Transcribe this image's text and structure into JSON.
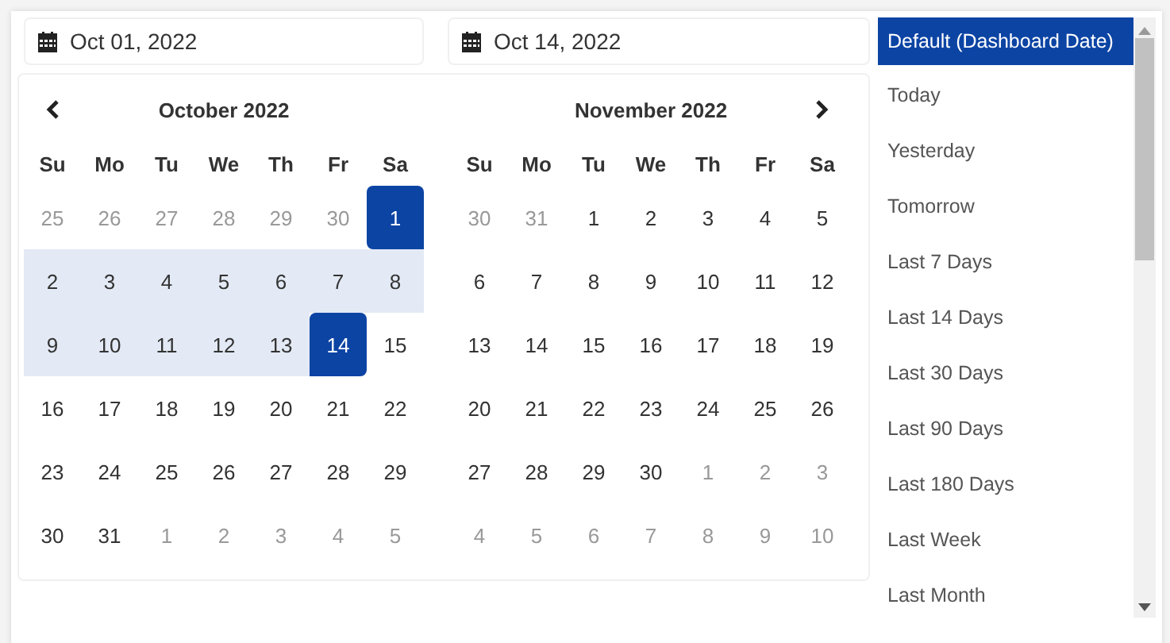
{
  "start_field": {
    "value": "Oct 01, 2022"
  },
  "end_field": {
    "value": "Oct 14, 2022"
  },
  "calendars": [
    {
      "title": "October 2022",
      "kind": "prev",
      "weekdays": [
        "Su",
        "Mo",
        "Tu",
        "We",
        "Th",
        "Fr",
        "Sa"
      ],
      "weeks": [
        [
          {
            "day": "25",
            "kind": "off"
          },
          {
            "day": "26",
            "kind": "off"
          },
          {
            "day": "27",
            "kind": "off"
          },
          {
            "day": "28",
            "kind": "off"
          },
          {
            "day": "29",
            "kind": "off"
          },
          {
            "day": "30",
            "kind": "off"
          },
          {
            "day": "1",
            "kind": "start"
          }
        ],
        [
          {
            "day": "2",
            "kind": "range"
          },
          {
            "day": "3",
            "kind": "range"
          },
          {
            "day": "4",
            "kind": "range"
          },
          {
            "day": "5",
            "kind": "range"
          },
          {
            "day": "6",
            "kind": "range"
          },
          {
            "day": "7",
            "kind": "range"
          },
          {
            "day": "8",
            "kind": "range"
          }
        ],
        [
          {
            "day": "9",
            "kind": "range"
          },
          {
            "day": "10",
            "kind": "range"
          },
          {
            "day": "11",
            "kind": "range"
          },
          {
            "day": "12",
            "kind": "range"
          },
          {
            "day": "13",
            "kind": "range"
          },
          {
            "day": "14",
            "kind": "end"
          },
          {
            "day": "15",
            "kind": "normal"
          }
        ],
        [
          {
            "day": "16",
            "kind": "normal"
          },
          {
            "day": "17",
            "kind": "normal"
          },
          {
            "day": "18",
            "kind": "normal"
          },
          {
            "day": "19",
            "kind": "normal"
          },
          {
            "day": "20",
            "kind": "normal"
          },
          {
            "day": "21",
            "kind": "normal"
          },
          {
            "day": "22",
            "kind": "normal"
          }
        ],
        [
          {
            "day": "23",
            "kind": "normal"
          },
          {
            "day": "24",
            "kind": "normal"
          },
          {
            "day": "25",
            "kind": "normal"
          },
          {
            "day": "26",
            "kind": "normal"
          },
          {
            "day": "27",
            "kind": "normal"
          },
          {
            "day": "28",
            "kind": "normal"
          },
          {
            "day": "29",
            "kind": "normal"
          }
        ],
        [
          {
            "day": "30",
            "kind": "normal"
          },
          {
            "day": "31",
            "kind": "normal"
          },
          {
            "day": "1",
            "kind": "off"
          },
          {
            "day": "2",
            "kind": "off"
          },
          {
            "day": "3",
            "kind": "off"
          },
          {
            "day": "4",
            "kind": "off"
          },
          {
            "day": "5",
            "kind": "off"
          }
        ]
      ]
    },
    {
      "title": "November 2022",
      "kind": "next",
      "weekdays": [
        "Su",
        "Mo",
        "Tu",
        "We",
        "Th",
        "Fr",
        "Sa"
      ],
      "weeks": [
        [
          {
            "day": "30",
            "kind": "off"
          },
          {
            "day": "31",
            "kind": "off"
          },
          {
            "day": "1",
            "kind": "normal"
          },
          {
            "day": "2",
            "kind": "normal"
          },
          {
            "day": "3",
            "kind": "normal"
          },
          {
            "day": "4",
            "kind": "normal"
          },
          {
            "day": "5",
            "kind": "normal"
          }
        ],
        [
          {
            "day": "6",
            "kind": "normal"
          },
          {
            "day": "7",
            "kind": "normal"
          },
          {
            "day": "8",
            "kind": "normal"
          },
          {
            "day": "9",
            "kind": "normal"
          },
          {
            "day": "10",
            "kind": "normal"
          },
          {
            "day": "11",
            "kind": "normal"
          },
          {
            "day": "12",
            "kind": "normal"
          }
        ],
        [
          {
            "day": "13",
            "kind": "normal"
          },
          {
            "day": "14",
            "kind": "normal"
          },
          {
            "day": "15",
            "kind": "normal"
          },
          {
            "day": "16",
            "kind": "normal"
          },
          {
            "day": "17",
            "kind": "normal"
          },
          {
            "day": "18",
            "kind": "normal"
          },
          {
            "day": "19",
            "kind": "normal"
          }
        ],
        [
          {
            "day": "20",
            "kind": "normal"
          },
          {
            "day": "21",
            "kind": "normal"
          },
          {
            "day": "22",
            "kind": "normal"
          },
          {
            "day": "23",
            "kind": "normal"
          },
          {
            "day": "24",
            "kind": "normal"
          },
          {
            "day": "25",
            "kind": "normal"
          },
          {
            "day": "26",
            "kind": "normal"
          }
        ],
        [
          {
            "day": "27",
            "kind": "normal"
          },
          {
            "day": "28",
            "kind": "normal"
          },
          {
            "day": "29",
            "kind": "normal"
          },
          {
            "day": "30",
            "kind": "normal"
          },
          {
            "day": "1",
            "kind": "off"
          },
          {
            "day": "2",
            "kind": "off"
          },
          {
            "day": "3",
            "kind": "off"
          }
        ],
        [
          {
            "day": "4",
            "kind": "off"
          },
          {
            "day": "5",
            "kind": "off"
          },
          {
            "day": "6",
            "kind": "off"
          },
          {
            "day": "7",
            "kind": "off"
          },
          {
            "day": "8",
            "kind": "off"
          },
          {
            "day": "9",
            "kind": "off"
          },
          {
            "day": "10",
            "kind": "off"
          }
        ]
      ]
    }
  ],
  "ranges": [
    {
      "label": "Default (Dashboard Date)",
      "selected": true
    },
    {
      "label": "Today",
      "selected": false
    },
    {
      "label": "Yesterday",
      "selected": false
    },
    {
      "label": "Tomorrow",
      "selected": false
    },
    {
      "label": "Last 7 Days",
      "selected": false
    },
    {
      "label": "Last 14 Days",
      "selected": false
    },
    {
      "label": "Last 30 Days",
      "selected": false
    },
    {
      "label": "Last 90 Days",
      "selected": false
    },
    {
      "label": "Last 180 Days",
      "selected": false
    },
    {
      "label": "Last Week",
      "selected": false
    },
    {
      "label": "Last Month",
      "selected": false
    }
  ]
}
